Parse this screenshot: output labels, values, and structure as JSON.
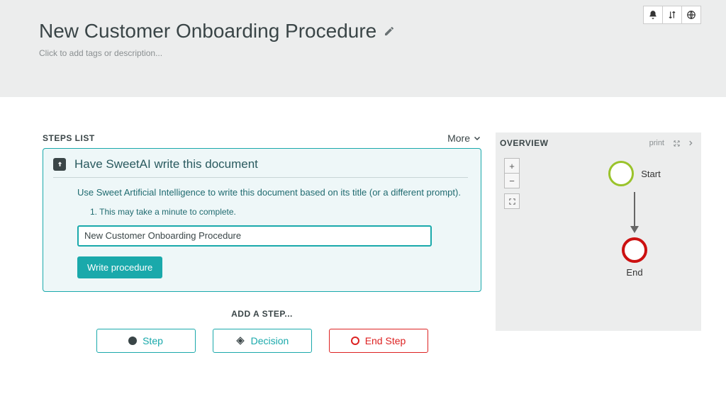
{
  "header": {
    "title": "New Customer Onboarding Procedure",
    "tags_placeholder": "Click to add tags or description..."
  },
  "steps_list": {
    "title": "STEPS LIST",
    "more_label": "More",
    "ai_card": {
      "title": "Have SweetAI write this document",
      "description": "Use Sweet Artificial Intelligence to write this document based on its title (or a different prompt).",
      "note": "1. This may take a minute to complete.",
      "input_value": "New Customer Onboarding Procedure",
      "button_label": "Write procedure"
    },
    "add_step_label": "ADD A STEP...",
    "buttons": {
      "step": "Step",
      "decision": "Decision",
      "end": "End Step"
    }
  },
  "overview": {
    "title": "OVERVIEW",
    "print_label": "print",
    "start_label": "Start",
    "end_label": "End",
    "zoom_in": "+",
    "zoom_out": "−"
  }
}
